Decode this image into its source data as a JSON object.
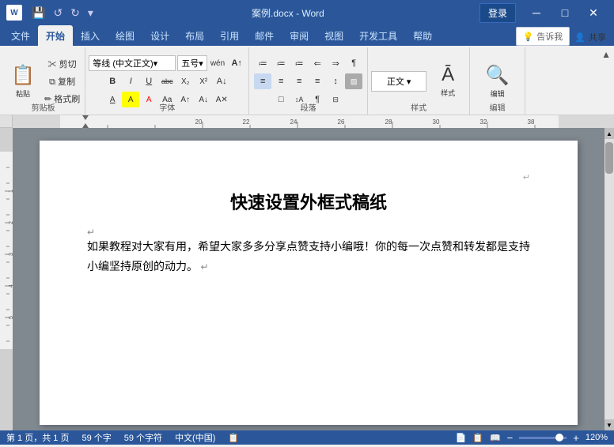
{
  "titlebar": {
    "filename": "案例.docx",
    "app": "Word",
    "full_title": "案例.docx - Word",
    "login": "登录",
    "minimize": "─",
    "restore": "□",
    "close": "✕",
    "quick_save": "💾",
    "undo": "↺",
    "redo": "↻",
    "customize": "▾"
  },
  "ribbon": {
    "tabs": [
      "文件",
      "开始",
      "插入",
      "绘图",
      "设计",
      "布局",
      "引用",
      "邮件",
      "审阅",
      "视图",
      "开发工具",
      "帮助"
    ],
    "active_tab": "开始",
    "tell_me": "告诉我",
    "share": "共享",
    "groups": {
      "clipboard": {
        "label": "剪贴板",
        "paste": "粘贴",
        "cut": "✂",
        "copy": "⧉",
        "format_painter": "✏"
      },
      "font": {
        "label": "字体",
        "font_name": "等线 (中文正文)",
        "font_size": "五号",
        "bold": "B",
        "italic": "I",
        "underline": "U",
        "strikethrough": "abc",
        "subscript": "X₂",
        "superscript": "X²",
        "font_color": "A",
        "highlight": "A",
        "grow": "A↑",
        "shrink": "A↓",
        "clear": "A"
      },
      "paragraph": {
        "label": "段落",
        "bullets": "≡",
        "numbering": "≡",
        "indent_decrease": "⇐",
        "indent_increase": "⇒",
        "align_left": "≡",
        "align_center": "≡",
        "align_right": "≡",
        "justify": "≡",
        "line_spacing": "↕",
        "shading": "▨",
        "borders": "□",
        "sort": "↕A",
        "show_para": "¶"
      },
      "styles": {
        "label": "样式",
        "title": "样式"
      },
      "editing": {
        "label": "编辑",
        "title": "编辑"
      }
    }
  },
  "document": {
    "title": "快速设置外框式稿纸",
    "body": "如果教程对大家有用，希望大家多多分享点赞支持小编哦！你的每一次点赞和转发都是支持小编坚持原创的动力。",
    "pilcrow": "↵"
  },
  "statusbar": {
    "page_info": "第 1 页，共 1 页",
    "word_count": "59 个字",
    "char_count": "59 个字符",
    "language": "中文(中国)",
    "layout_icon": "📄",
    "view_icons": [
      "📄",
      "📋",
      "📊"
    ],
    "zoom_level": "120%",
    "zoom_minus": "−",
    "zoom_plus": "+"
  }
}
